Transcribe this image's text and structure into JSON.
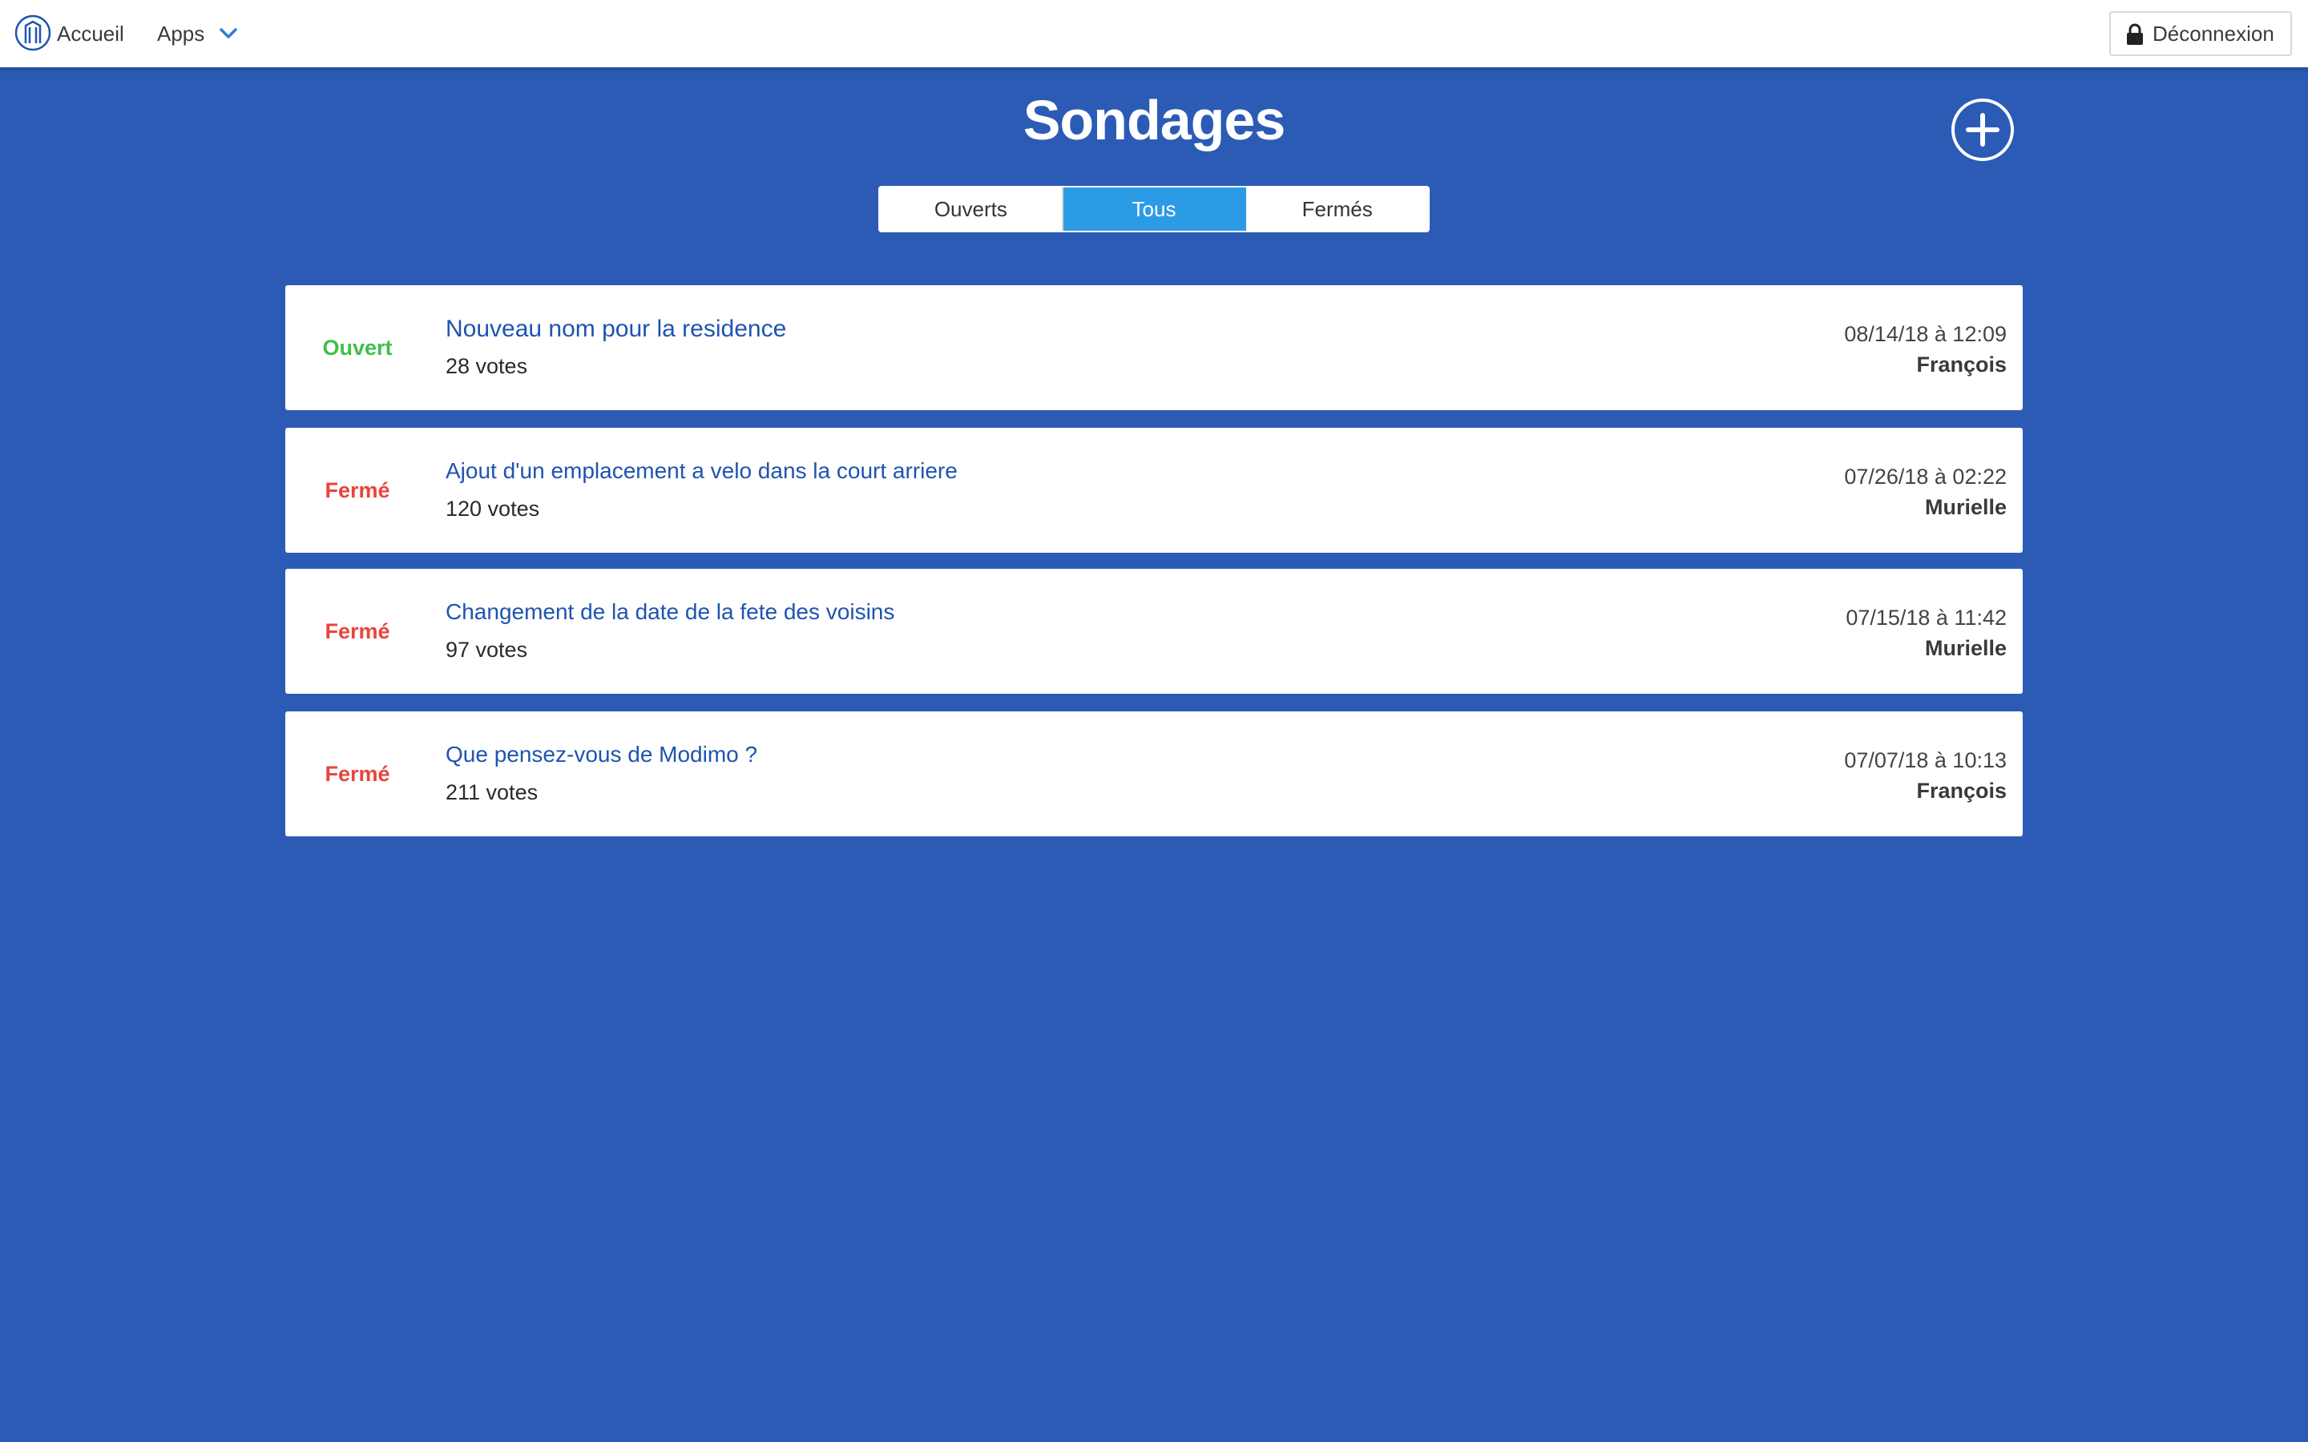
{
  "navbar": {
    "home_label": "Accueil",
    "apps_label": "Apps",
    "logout_label": "Déconnexion"
  },
  "page": {
    "title": "Sondages"
  },
  "filters": [
    {
      "label": "Ouverts",
      "active": false
    },
    {
      "label": "Tous",
      "active": true
    },
    {
      "label": "Fermés",
      "active": false
    }
  ],
  "colors": {
    "background": "#2c5bb5",
    "open_status": "#3dbf4a",
    "closed_status": "#e8453c",
    "active_tab": "#2b9be6",
    "poll_title": "#1e54b0"
  },
  "polls": [
    {
      "status": "Ouvert",
      "status_type": "open",
      "title": "Nouveau nom pour la residence",
      "votes": "28 votes",
      "date": "08/14/18 à 12:09",
      "author": "François"
    },
    {
      "status": "Fermé",
      "status_type": "closed",
      "title": "Ajout d'un emplacement a velo dans la court arriere",
      "votes": "120 votes",
      "date": "07/26/18 à 02:22",
      "author": "Murielle"
    },
    {
      "status": "Fermé",
      "status_type": "closed",
      "title": "Changement de la date de la fete des voisins",
      "votes": "97 votes",
      "date": "07/15/18 à 11:42",
      "author": "Murielle"
    },
    {
      "status": "Fermé",
      "status_type": "closed",
      "title": "Que pensez-vous de Modimo ?",
      "votes": "211 votes",
      "date": "07/07/18 à 10:13",
      "author": "François"
    }
  ]
}
